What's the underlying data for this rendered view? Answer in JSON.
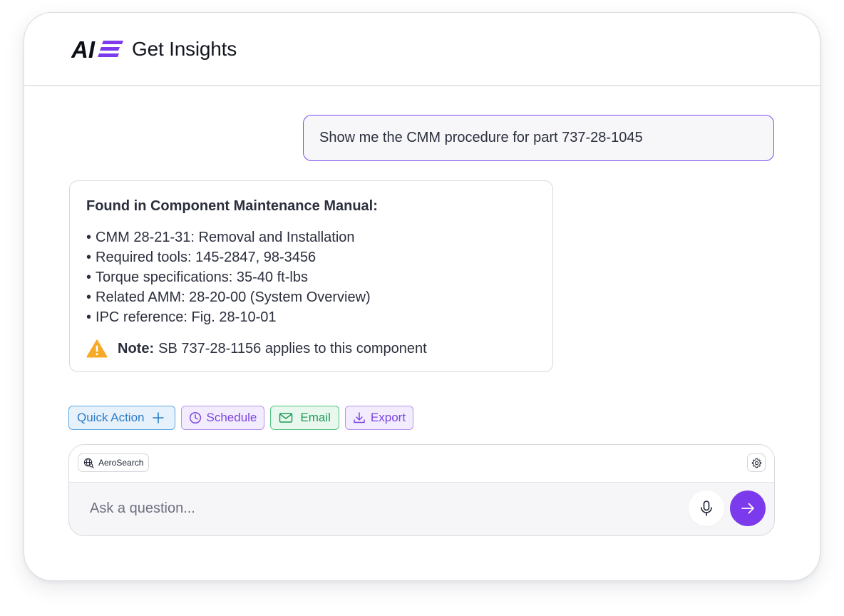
{
  "header": {
    "logo_text": "AI",
    "title": "Get Insights"
  },
  "conversation": {
    "user_message": "Show me the CMM procedure for part 737-28-1045",
    "ai_response": {
      "heading": "Found in Component Maintenance Manual:",
      "items": [
        "CMM 28-21-31: Removal and Installation",
        "Required tools: 145-2847, 98-3456",
        "Torque specifications: 35-40 ft-lbs",
        "Related AMM: 28-20-00 (System Overview)",
        "IPC reference: Fig. 28-10-01"
      ],
      "note_label": "Note:",
      "note_text": "SB 737-28-1156 applies to this component",
      "note_icon": "warning-icon"
    }
  },
  "actions": [
    {
      "label": "Quick Action",
      "icon": "plus-icon",
      "color": "#2a7cc7"
    },
    {
      "label": "Schedule",
      "icon": "clock-icon",
      "color": "#7b46e0"
    },
    {
      "label": "Email",
      "icon": "mail-icon",
      "color": "#1e9b57"
    },
    {
      "label": "Export",
      "icon": "download-icon",
      "color": "#7b46e0"
    }
  ],
  "composer": {
    "source_label": "AeroSearch",
    "placeholder": "Ask a question...",
    "accent_color": "#7c3aed"
  }
}
